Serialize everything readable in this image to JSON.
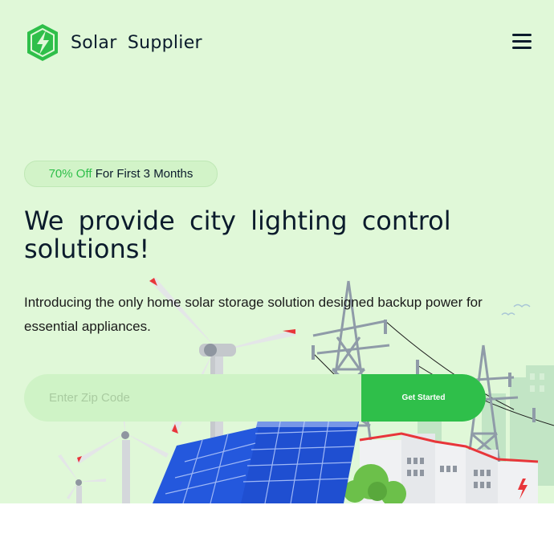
{
  "header": {
    "logo_icon": "lightning-bolt-hexagon-icon",
    "brand_name": "Solar Supplier",
    "menu_icon": "hamburger-menu-icon"
  },
  "hero": {
    "promo": {
      "highlight": "70% Off",
      "rest": "For First 3 Months"
    },
    "headline": "We provide city lighting control solutions!",
    "description": "Introducing the only home solar storage solution designed backup power for essential appliances.",
    "zip_form": {
      "placeholder": "Enter Zip Code",
      "value": "",
      "button_label": "Get Started"
    },
    "illustration": "solar-panels-wind-turbines-power-lines-illustration"
  },
  "colors": {
    "hero_background": "#e0f8d8",
    "accent_green": "#2fbf4a",
    "dark_text": "#0b1b2c",
    "solar_panel_blue": "#1f4fd1"
  }
}
